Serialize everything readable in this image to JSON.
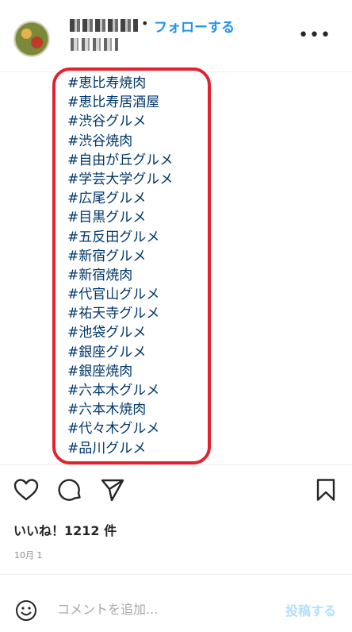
{
  "header": {
    "separator": "•",
    "follow_label": "フォローする",
    "more_label": "•••"
  },
  "caption": {
    "hashtags": [
      "#恵比寿焼肉",
      "#恵比寿居酒屋",
      "#渋谷グルメ",
      "#渋谷焼肉",
      "#自由が丘グルメ",
      "#学芸大学グルメ",
      "#広尾グルメ",
      "#目黒グルメ",
      "#五反田グルメ",
      "#新宿グルメ",
      "#新宿焼肉",
      "#代官山グルメ",
      "#祐天寺グルメ",
      "#池袋グルメ",
      "#銀座グルメ",
      "#銀座焼肉",
      "#六本木グルメ",
      "#六本木焼肉",
      "#代々木グルメ",
      "#品川グルメ"
    ]
  },
  "actions": {
    "icons": [
      "heart-icon",
      "comment-icon",
      "share-icon",
      "bookmark-icon"
    ]
  },
  "likes": {
    "label": "いいね！1212 件"
  },
  "date": {
    "label": "10月 1"
  },
  "comment": {
    "placeholder": "コメントを追加...",
    "post_label": "投稿する",
    "emoji_icon": "smiley-icon"
  },
  "colors": {
    "follow": "#1f95e9",
    "hashtag": "#00376b",
    "highlight": "#e0232e",
    "post_disabled": "#b2dffc"
  }
}
